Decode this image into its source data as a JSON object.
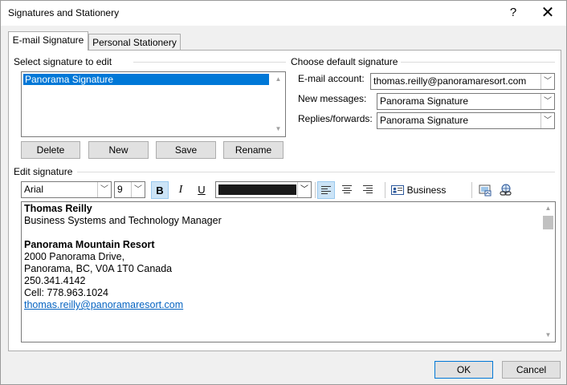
{
  "window": {
    "title": "Signatures and Stationery",
    "help_glyph": "?",
    "close_glyph": "✕"
  },
  "tabs": [
    {
      "label": "E-mail Signature",
      "active": true
    },
    {
      "label": "Personal Stationery",
      "active": false
    }
  ],
  "select_section": {
    "label": "Select signature to edit",
    "items": [
      "Panorama Signature"
    ],
    "selected_index": 0
  },
  "signature_buttons": {
    "delete": "Delete",
    "new": "New",
    "save": "Save",
    "rename": "Rename"
  },
  "default_section": {
    "label": "Choose default signature",
    "email_account_label": "E-mail account:",
    "email_account_value": "thomas.reilly@panoramaresort.com",
    "new_messages_label": "New messages:",
    "new_messages_value": "Panorama Signature",
    "replies_label": "Replies/forwards:",
    "replies_value": "Panorama Signature"
  },
  "edit_section": {
    "label": "Edit signature"
  },
  "toolbar": {
    "font_name": "Arial",
    "font_size": "9",
    "bold_glyph": "B",
    "italic_glyph": "I",
    "underline_glyph": "U",
    "font_color": "#1a1a1a",
    "business_card_label": "Business Card",
    "bold_active": true,
    "align_left_active": true,
    "icons": [
      "bold-icon",
      "italic-icon",
      "underline-icon",
      "align-left-icon",
      "align-center-icon",
      "align-right-icon",
      "business-card-icon",
      "insert-picture-icon",
      "insert-hyperlink-icon"
    ]
  },
  "signature_content": {
    "name": "Thomas Reilly",
    "job_title": "Business Systems and Technology Manager",
    "company": "Panorama Mountain Resort",
    "address_line1": "2000 Panorama Drive,",
    "address_line2": "Panorama, BC, V0A 1T0 Canada",
    "phone": "250.341.4142",
    "cell": "Cell: 778.963.1024",
    "email": "thomas.reilly@panoramaresort.com"
  },
  "footer": {
    "ok": "OK",
    "cancel": "Cancel"
  },
  "colors": {
    "selection": "#0078d7",
    "link": "#0563c1",
    "pressed_bg": "#cce4f7"
  }
}
